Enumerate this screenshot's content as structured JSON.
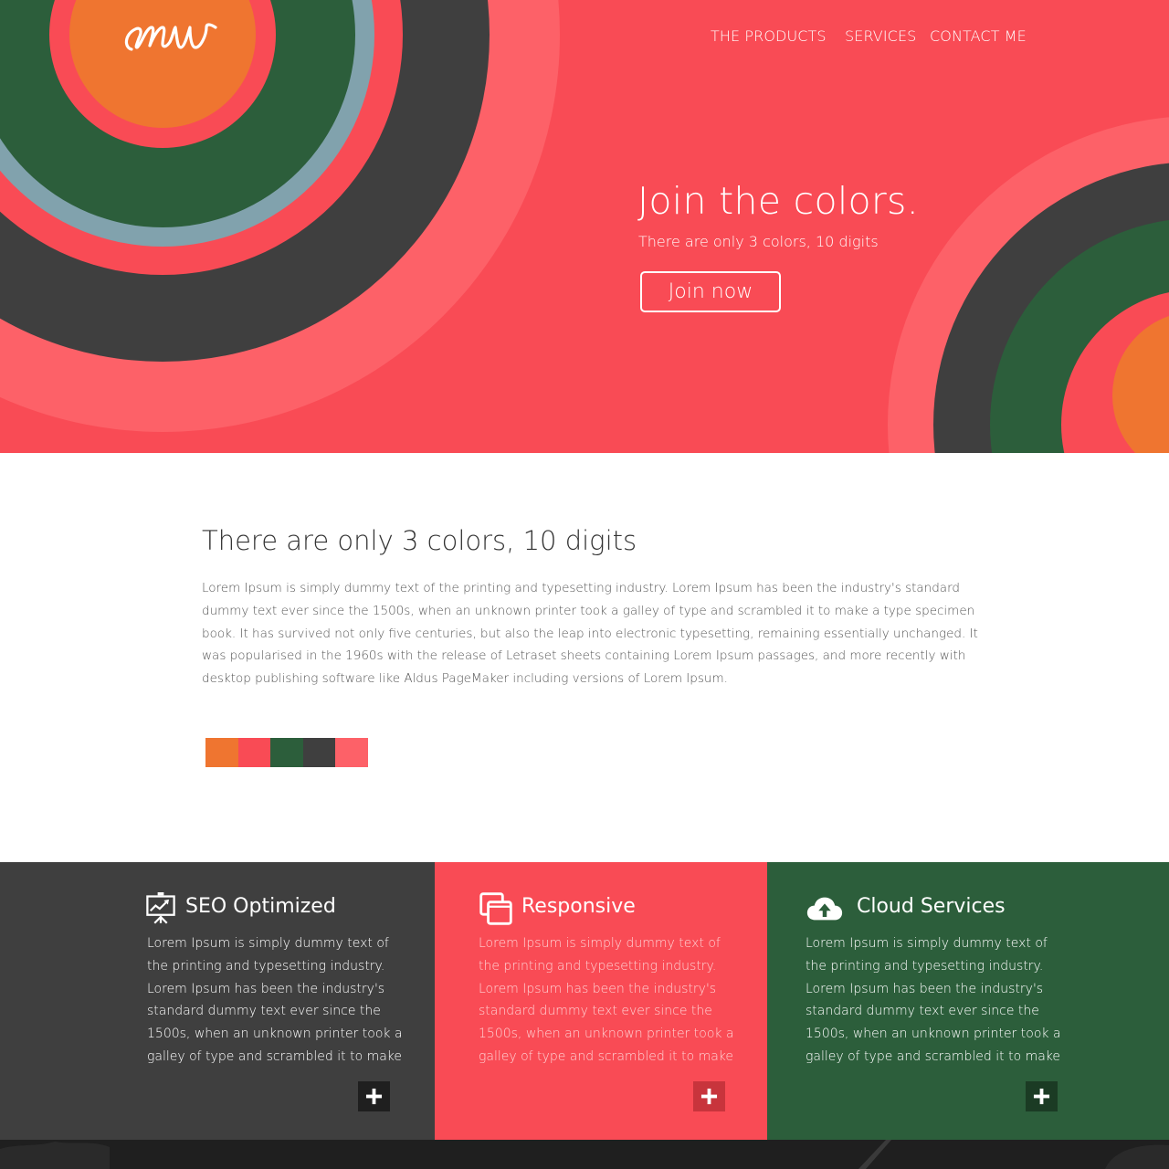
{
  "colors": {
    "orange": "#ef7530",
    "red": "#f94b55",
    "green": "#2c5e3b",
    "dark": "#3f3f3f",
    "salmon": "#fd6168",
    "steel": "#81a2ad"
  },
  "header": {
    "logo_text": "Mw",
    "nav": {
      "products": "THE PRODUCTS",
      "services": "SERVICES",
      "contact": "CONTACT ME"
    }
  },
  "hero": {
    "title": "Join the colors.",
    "subtitle": "There are only 3 colors, 10 digits",
    "button_label": "Join now"
  },
  "about": {
    "title": "There are only 3 colors, 10 digits",
    "text": "Lorem Ipsum is simply dummy text of the printing and typesetting industry. Lorem Ipsum has been the industry's standard dummy text ever since the 1500s, when an unknown printer took a galley of type and scrambled it to make a type specimen book. It has survived not only five centuries, but also the leap into electronic typesetting, remaining essentially unchanged. It was popularised in the 1960s with the release of Letraset sheets containing Lorem Ipsum passages, and more recently with desktop publishing software like Aldus PageMaker including versions of Lorem Ipsum.",
    "swatches": [
      "#ef7530",
      "#f94b55",
      "#2c5e3b",
      "#3f3f3f",
      "#fd6168"
    ]
  },
  "features": [
    {
      "title": "SEO Optimized",
      "icon": "presentation-chart-icon",
      "text": "Lorem Ipsum is simply dummy text of the printing and typesetting industry. Lorem Ipsum has been the industry's standard dummy text ever since the 1500s, when an unknown printer took a galley of type and scrambled it to make",
      "background": "#3f3f3f",
      "button_color": "#1f1f1f"
    },
    {
      "title": "Responsive",
      "icon": "devices-icon",
      "text": "Lorem Ipsum is simply dummy text of the printing and typesetting industry. Lorem Ipsum has been the industry's standard dummy text ever since the 1500s, when an unknown printer took a galley of type and scrambled it to make",
      "background": "#f94b55",
      "button_color": "#c8343c"
    },
    {
      "title": "Cloud Services",
      "icon": "cloud-upload-icon",
      "text": "Lorem Ipsum is simply dummy text of the printing and typesetting industry. Lorem Ipsum has been the industry's standard dummy text ever since the 1500s, when an unknown printer took a galley of type and scrambled it to make",
      "background": "#2c5e3b",
      "button_color": "#1b3b24"
    }
  ]
}
